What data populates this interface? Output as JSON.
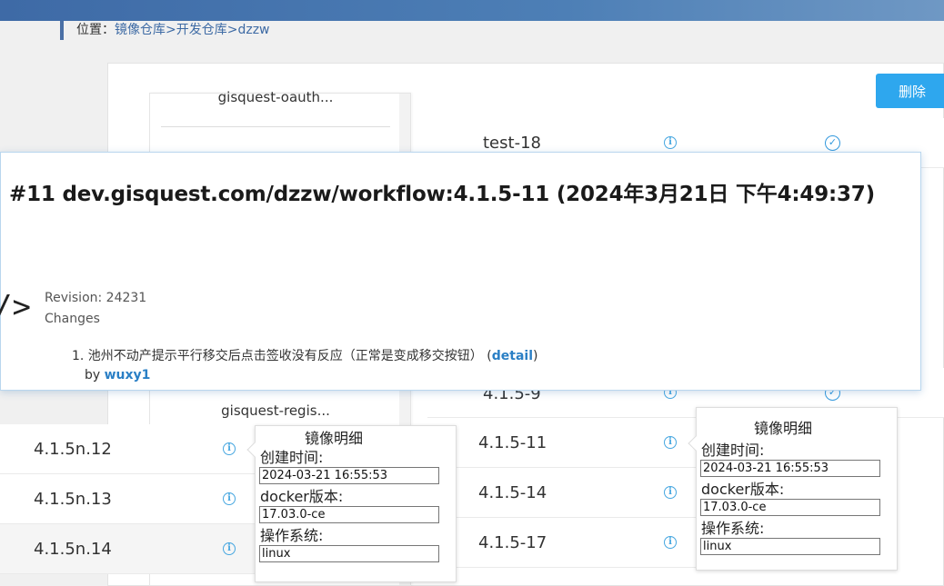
{
  "breadcrumb": {
    "prefix": "位置：",
    "items": [
      "镜像仓库>",
      "开发仓库>",
      "dzzw"
    ]
  },
  "toolbar": {
    "delete_label": "删除"
  },
  "left_list": {
    "items": [
      "gisquest-oauth...",
      "gisquest-regis..."
    ]
  },
  "right_rows": [
    {
      "tag": "test-18",
      "info": "i",
      "check": "✓"
    },
    {
      "tag": "4.1.5-9",
      "info": "i",
      "check": "✓"
    },
    {
      "tag": "4.1.5-11",
      "info": "i"
    },
    {
      "tag": "4.1.5-14",
      "info": "i"
    },
    {
      "tag": "4.1.5-17",
      "info": "i"
    }
  ],
  "left_rows": [
    {
      "tag": "4.1.5n.12",
      "info": "i"
    },
    {
      "tag": "4.1.5n.13",
      "info": "i"
    },
    {
      "tag": "4.1.5n.14",
      "info": "i"
    }
  ],
  "popup_left": {
    "title": "镜像明细",
    "created_label": "创建时间:",
    "created_value": "2024-03-21 16:55:53",
    "docker_label": "docker版本:",
    "docker_value": "17.03.0-ce",
    "os_label": "操作系统:",
    "os_value": "linux"
  },
  "popup_right": {
    "title": "镜像明细",
    "created_label": "创建时间:",
    "created_value": "2024-03-21 16:55:53",
    "docker_label": "docker版本:",
    "docker_value": "17.03.0-ce",
    "os_label": "操作系统:",
    "os_value": "linux"
  },
  "tooltip": {
    "title": "#11 dev.gisquest.com/dzzw/workflow:4.1.5-11 (2024年3月21日 下午4:49:37)",
    "revision": "Revision: 24231",
    "changes_label": "Changes",
    "change_text": "1. 池州不动产提示平行移交后点击签收没有反应（正常是变成移交按钮）",
    "detail_link": "detail",
    "by_label": "by",
    "author": "wuxy1",
    "icon": "code-icon"
  }
}
